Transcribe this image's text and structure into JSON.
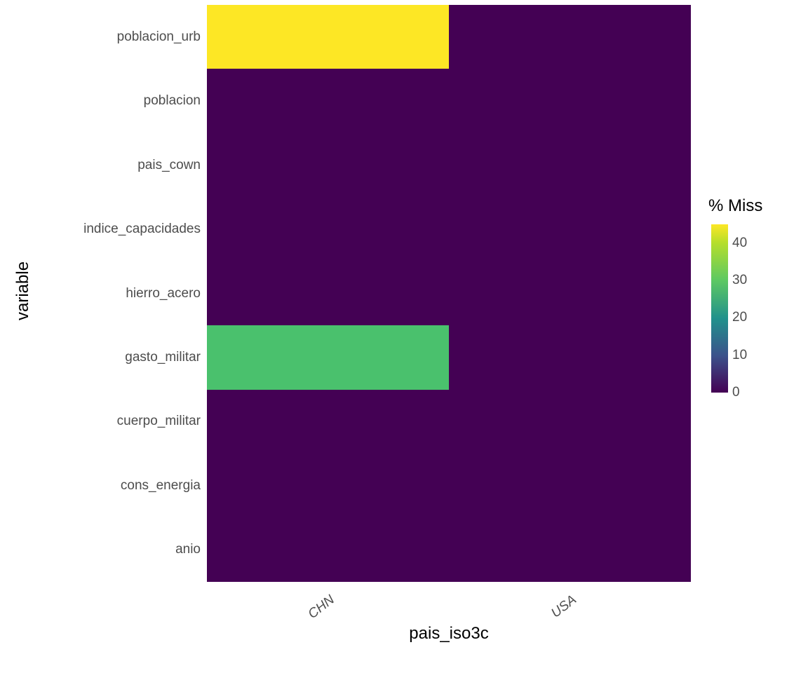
{
  "chart_data": {
    "type": "heatmap",
    "xlabel": "pais_iso3c",
    "ylabel": "variable",
    "x_categories": [
      "CHN",
      "USA"
    ],
    "y_categories": [
      "poblacion_urb",
      "poblacion",
      "pais_cown",
      "indice_capacidades",
      "hierro_acero",
      "gasto_militar",
      "cuerpo_militar",
      "cons_energia",
      "anio"
    ],
    "values": [
      [
        45,
        0
      ],
      [
        0,
        0
      ],
      [
        0,
        0
      ],
      [
        0,
        0
      ],
      [
        0,
        0
      ],
      [
        26,
        0
      ],
      [
        0,
        0
      ],
      [
        0,
        0
      ],
      [
        0,
        0
      ]
    ],
    "legend": {
      "title": "% Miss",
      "ticks": [
        0,
        10,
        20,
        30,
        40
      ],
      "min": 0,
      "max": 45,
      "gradient_stops": [
        {
          "pos": 0.0,
          "color": "#440154"
        },
        {
          "pos": 0.22,
          "color": "#3b528b"
        },
        {
          "pos": 0.44,
          "color": "#21918c"
        },
        {
          "pos": 0.67,
          "color": "#5ec962"
        },
        {
          "pos": 0.89,
          "color": "#b5de2b"
        },
        {
          "pos": 1.0,
          "color": "#fde725"
        }
      ]
    },
    "value_colors": {
      "0": "#440154",
      "26": "#4ac16d",
      "45": "#fde725"
    }
  }
}
